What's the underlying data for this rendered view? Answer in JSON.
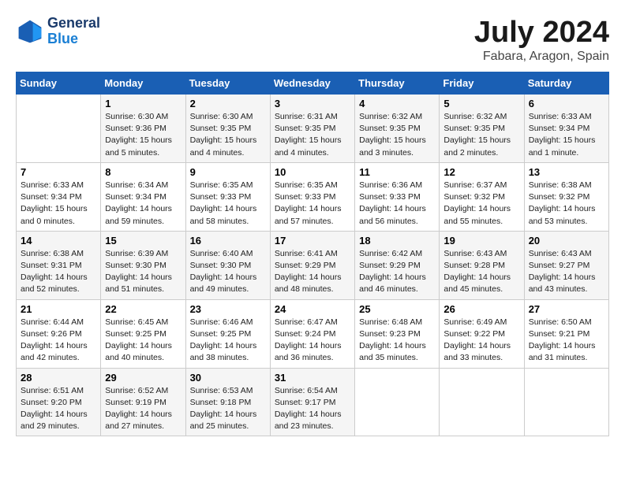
{
  "logo": {
    "name": "GeneralBlue",
    "line1": "General",
    "line2": "Blue"
  },
  "title": "July 2024",
  "location": "Fabara, Aragon, Spain",
  "days_of_week": [
    "Sunday",
    "Monday",
    "Tuesday",
    "Wednesday",
    "Thursday",
    "Friday",
    "Saturday"
  ],
  "weeks": [
    [
      {
        "day": "",
        "sunrise": "",
        "sunset": "",
        "daylight": ""
      },
      {
        "day": "1",
        "sunrise": "6:30 AM",
        "sunset": "9:36 PM",
        "daylight": "15 hours and 5 minutes."
      },
      {
        "day": "2",
        "sunrise": "6:30 AM",
        "sunset": "9:35 PM",
        "daylight": "15 hours and 4 minutes."
      },
      {
        "day": "3",
        "sunrise": "6:31 AM",
        "sunset": "9:35 PM",
        "daylight": "15 hours and 4 minutes."
      },
      {
        "day": "4",
        "sunrise": "6:32 AM",
        "sunset": "9:35 PM",
        "daylight": "15 hours and 3 minutes."
      },
      {
        "day": "5",
        "sunrise": "6:32 AM",
        "sunset": "9:35 PM",
        "daylight": "15 hours and 2 minutes."
      },
      {
        "day": "6",
        "sunrise": "6:33 AM",
        "sunset": "9:34 PM",
        "daylight": "15 hours and 1 minute."
      }
    ],
    [
      {
        "day": "7",
        "sunrise": "6:33 AM",
        "sunset": "9:34 PM",
        "daylight": "15 hours and 0 minutes."
      },
      {
        "day": "8",
        "sunrise": "6:34 AM",
        "sunset": "9:34 PM",
        "daylight": "14 hours and 59 minutes."
      },
      {
        "day": "9",
        "sunrise": "6:35 AM",
        "sunset": "9:33 PM",
        "daylight": "14 hours and 58 minutes."
      },
      {
        "day": "10",
        "sunrise": "6:35 AM",
        "sunset": "9:33 PM",
        "daylight": "14 hours and 57 minutes."
      },
      {
        "day": "11",
        "sunrise": "6:36 AM",
        "sunset": "9:33 PM",
        "daylight": "14 hours and 56 minutes."
      },
      {
        "day": "12",
        "sunrise": "6:37 AM",
        "sunset": "9:32 PM",
        "daylight": "14 hours and 55 minutes."
      },
      {
        "day": "13",
        "sunrise": "6:38 AM",
        "sunset": "9:32 PM",
        "daylight": "14 hours and 53 minutes."
      }
    ],
    [
      {
        "day": "14",
        "sunrise": "6:38 AM",
        "sunset": "9:31 PM",
        "daylight": "14 hours and 52 minutes."
      },
      {
        "day": "15",
        "sunrise": "6:39 AM",
        "sunset": "9:30 PM",
        "daylight": "14 hours and 51 minutes."
      },
      {
        "day": "16",
        "sunrise": "6:40 AM",
        "sunset": "9:30 PM",
        "daylight": "14 hours and 49 minutes."
      },
      {
        "day": "17",
        "sunrise": "6:41 AM",
        "sunset": "9:29 PM",
        "daylight": "14 hours and 48 minutes."
      },
      {
        "day": "18",
        "sunrise": "6:42 AM",
        "sunset": "9:29 PM",
        "daylight": "14 hours and 46 minutes."
      },
      {
        "day": "19",
        "sunrise": "6:43 AM",
        "sunset": "9:28 PM",
        "daylight": "14 hours and 45 minutes."
      },
      {
        "day": "20",
        "sunrise": "6:43 AM",
        "sunset": "9:27 PM",
        "daylight": "14 hours and 43 minutes."
      }
    ],
    [
      {
        "day": "21",
        "sunrise": "6:44 AM",
        "sunset": "9:26 PM",
        "daylight": "14 hours and 42 minutes."
      },
      {
        "day": "22",
        "sunrise": "6:45 AM",
        "sunset": "9:25 PM",
        "daylight": "14 hours and 40 minutes."
      },
      {
        "day": "23",
        "sunrise": "6:46 AM",
        "sunset": "9:25 PM",
        "daylight": "14 hours and 38 minutes."
      },
      {
        "day": "24",
        "sunrise": "6:47 AM",
        "sunset": "9:24 PM",
        "daylight": "14 hours and 36 minutes."
      },
      {
        "day": "25",
        "sunrise": "6:48 AM",
        "sunset": "9:23 PM",
        "daylight": "14 hours and 35 minutes."
      },
      {
        "day": "26",
        "sunrise": "6:49 AM",
        "sunset": "9:22 PM",
        "daylight": "14 hours and 33 minutes."
      },
      {
        "day": "27",
        "sunrise": "6:50 AM",
        "sunset": "9:21 PM",
        "daylight": "14 hours and 31 minutes."
      }
    ],
    [
      {
        "day": "28",
        "sunrise": "6:51 AM",
        "sunset": "9:20 PM",
        "daylight": "14 hours and 29 minutes."
      },
      {
        "day": "29",
        "sunrise": "6:52 AM",
        "sunset": "9:19 PM",
        "daylight": "14 hours and 27 minutes."
      },
      {
        "day": "30",
        "sunrise": "6:53 AM",
        "sunset": "9:18 PM",
        "daylight": "14 hours and 25 minutes."
      },
      {
        "day": "31",
        "sunrise": "6:54 AM",
        "sunset": "9:17 PM",
        "daylight": "14 hours and 23 minutes."
      },
      {
        "day": "",
        "sunrise": "",
        "sunset": "",
        "daylight": ""
      },
      {
        "day": "",
        "sunrise": "",
        "sunset": "",
        "daylight": ""
      },
      {
        "day": "",
        "sunrise": "",
        "sunset": "",
        "daylight": ""
      }
    ]
  ]
}
